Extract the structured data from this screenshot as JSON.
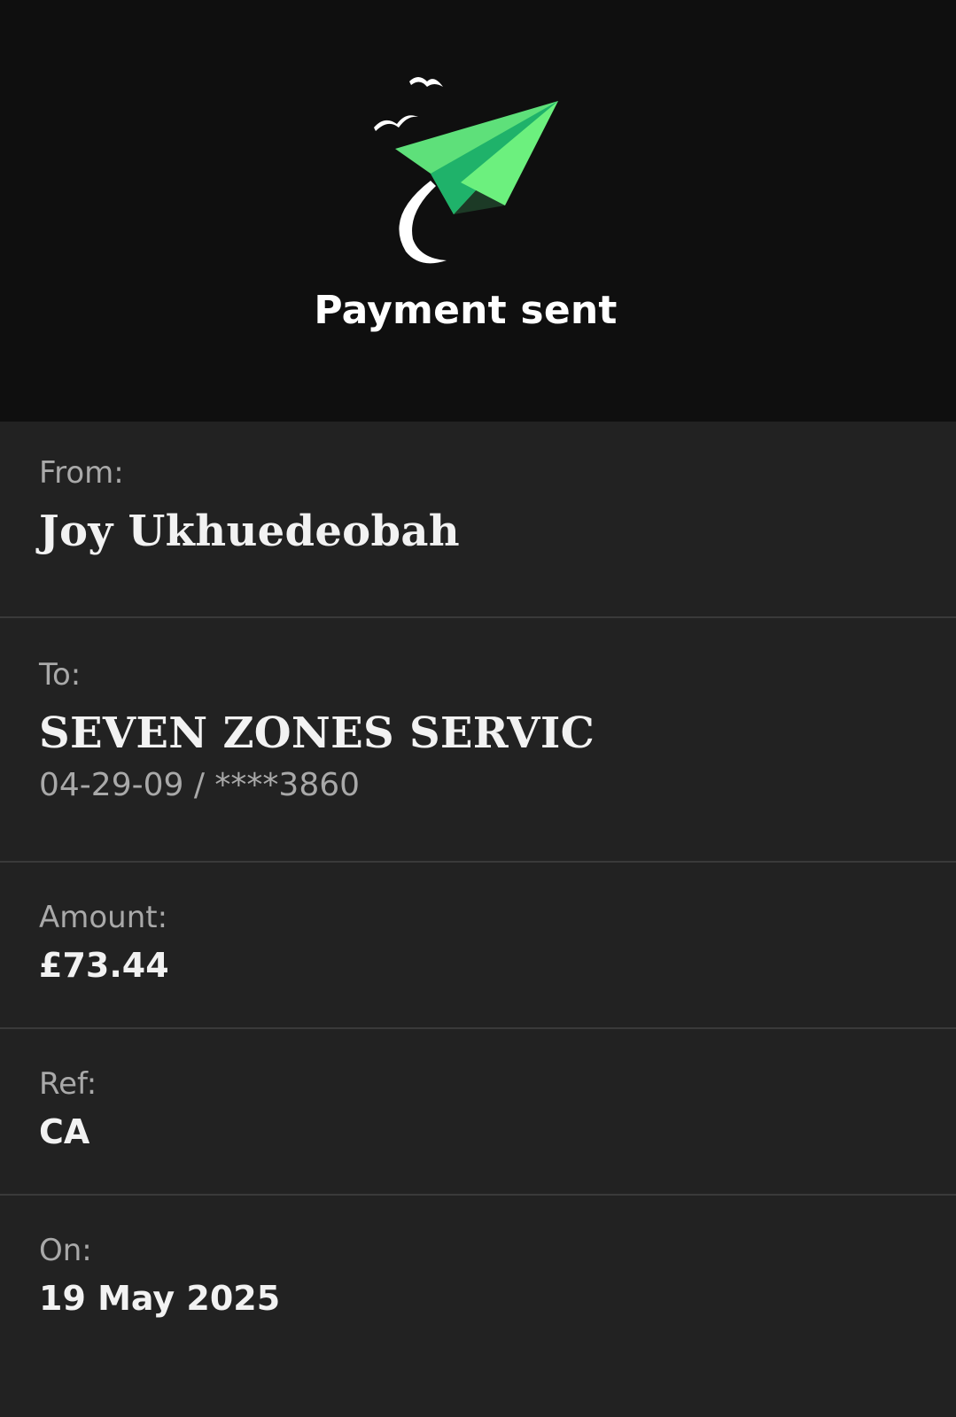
{
  "header": {
    "title": "Payment sent",
    "illustration": "paper-plane-with-birds-icon",
    "accent_color": "#5ee07a"
  },
  "details": {
    "from": {
      "label": "From:",
      "value": "Joy Ukhuedeobah"
    },
    "to": {
      "label": "To:",
      "value": "SEVEN ZONES SERVIC",
      "account": "04-29-09 / ****3860"
    },
    "amount": {
      "label": "Amount:",
      "value": "£73.44"
    },
    "ref": {
      "label": "Ref:",
      "value": "CA"
    },
    "on": {
      "label": "On:",
      "value": "19 May 2025"
    }
  }
}
